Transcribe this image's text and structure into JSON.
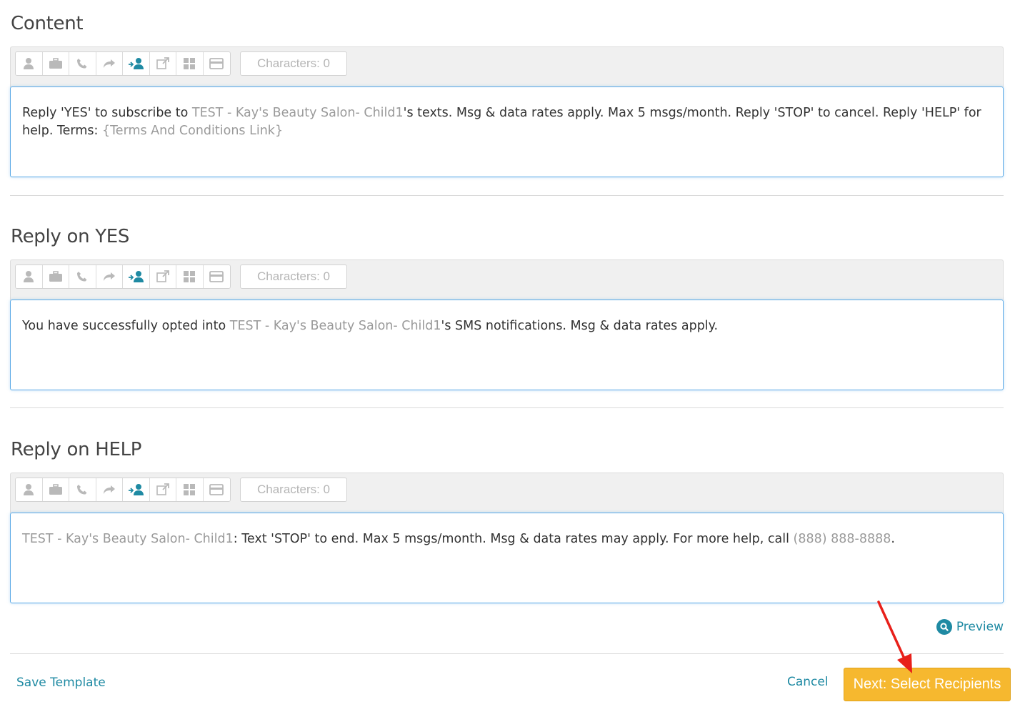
{
  "sections": [
    {
      "title": "Content",
      "characters": "Characters: 0",
      "message": {
        "t1": "Reply 'YES' to subscribe to ",
        "p1": "TEST - Kay's Beauty Salon- Child1",
        "t2": "'s texts. Msg & data rates apply. Max 5 msgs/month. Reply 'STOP' to cancel. Reply 'HELP' for help. Terms: ",
        "p2": "{Terms And Conditions Link}"
      }
    },
    {
      "title": "Reply on YES",
      "characters": "Characters: 0",
      "message": {
        "t1": "You have successfully opted into ",
        "p1": "TEST - Kay's Beauty Salon- Child1",
        "t2": "'s SMS notifications. Msg & data rates apply."
      }
    },
    {
      "title": "Reply on HELP",
      "characters": "Characters: 0",
      "message": {
        "p1": "TEST - Kay's Beauty Salon- Child1",
        "t1": ": Text 'STOP' to end. Max 5 msgs/month. Msg & data rates may apply. For more help, call ",
        "p2": "(888) 888-8888",
        "t2": "."
      }
    }
  ],
  "toolbar_icons": [
    "contact-name-icon",
    "business-icon",
    "phone-icon",
    "forward-icon",
    "assign-contact-icon",
    "external-link-icon",
    "grid-icon",
    "card-icon"
  ],
  "preview_label": "Preview",
  "save_template_label": "Save Template",
  "cancel_label": "Cancel",
  "next_label": "Next: Select Recipients",
  "colors": {
    "accent": "#1f8aa3",
    "primary_button": "#f6b82f",
    "placeholder_text": "#9a9a9a",
    "editor_border": "#5aa9e6",
    "annotation_arrow": "#e8201a"
  }
}
